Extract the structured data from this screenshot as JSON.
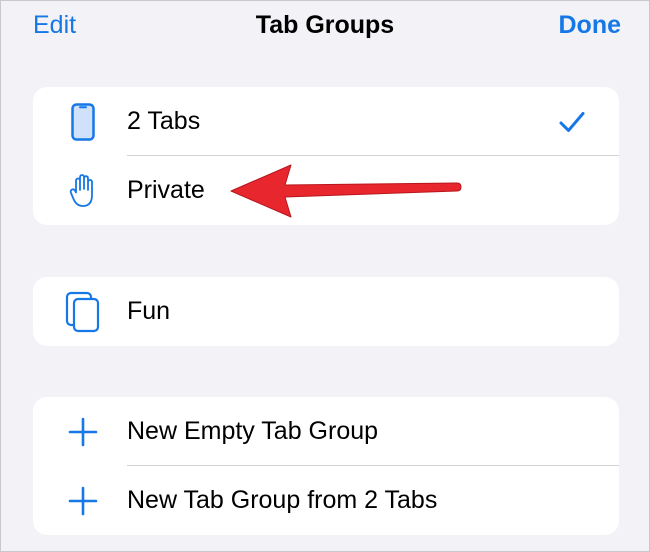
{
  "nav": {
    "edit_label": "Edit",
    "title": "Tab Groups",
    "done_label": "Done"
  },
  "groups": [
    {
      "label": "2 Tabs",
      "icon": "phone-icon",
      "selected": true
    },
    {
      "label": "Private",
      "icon": "hand-icon",
      "selected": false
    }
  ],
  "saved_groups": [
    {
      "label": "Fun",
      "icon": "tabs-stack-icon"
    }
  ],
  "actions": [
    {
      "label": "New Empty Tab Group",
      "icon": "plus-icon"
    },
    {
      "label": "New Tab Group from 2 Tabs",
      "icon": "plus-icon"
    }
  ],
  "colors": {
    "accent": "#1677e6",
    "background": "#f2f2f7",
    "card": "#ffffff",
    "separator": "#d1d1d6",
    "annotation_arrow": "#e8262e"
  }
}
